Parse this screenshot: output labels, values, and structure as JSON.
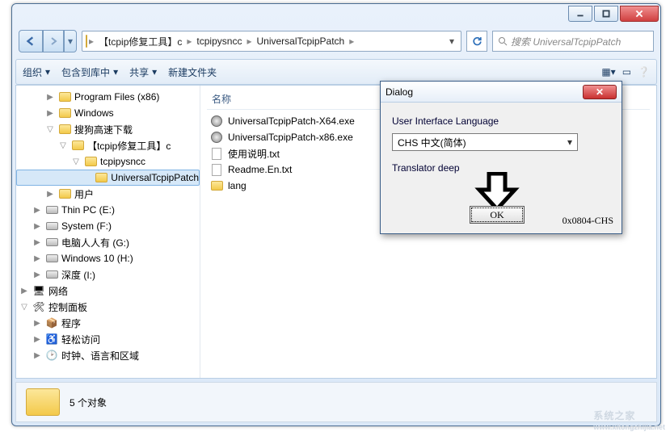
{
  "window": {
    "min_tip": "Minimize",
    "max_tip": "Maximize",
    "close_tip": "Close"
  },
  "address": {
    "crumbs": [
      "【tcpip修复工具】c",
      "tcpipysncc",
      "UniversalTcpipPatch"
    ],
    "sep": "▸"
  },
  "search": {
    "placeholder": "搜索 UniversalTcpipPatch"
  },
  "toolbar": {
    "organize": "组织",
    "include": "包含到库中",
    "share": "共享",
    "newfolder": "新建文件夹"
  },
  "columns": {
    "name": "名称"
  },
  "tree": [
    {
      "indent": 36,
      "icon": "folder",
      "label": "Program Files (x86)",
      "twisty": "▶"
    },
    {
      "indent": 36,
      "icon": "folder",
      "label": "Windows",
      "twisty": "▶"
    },
    {
      "indent": 36,
      "icon": "folder",
      "label": "搜狗高速下载",
      "twisty": "▽"
    },
    {
      "indent": 52,
      "icon": "folder",
      "label": "【tcpip修复工具】c",
      "twisty": "▽"
    },
    {
      "indent": 68,
      "icon": "folder",
      "label": "tcpipysncc",
      "twisty": "▽"
    },
    {
      "indent": 84,
      "icon": "folder",
      "label": "UniversalTcpipPatch",
      "twisty": "",
      "sel": true
    },
    {
      "indent": 36,
      "icon": "folder",
      "label": "用户",
      "twisty": "▶"
    },
    {
      "indent": 20,
      "icon": "drive",
      "label": "Thin PC (E:)",
      "twisty": "▶"
    },
    {
      "indent": 20,
      "icon": "drive",
      "label": "System (F:)",
      "twisty": "▶"
    },
    {
      "indent": 20,
      "icon": "drive",
      "label": "电脑人人有 (G:)",
      "twisty": "▶"
    },
    {
      "indent": 20,
      "icon": "drive",
      "label": "Windows 10 (H:)",
      "twisty": "▶"
    },
    {
      "indent": 20,
      "icon": "drive",
      "label": "深度 (I:)",
      "twisty": "▶"
    },
    {
      "indent": 4,
      "icon": "net",
      "label": "网络",
      "twisty": "▶"
    },
    {
      "indent": 4,
      "icon": "cpl",
      "label": "控制面板",
      "twisty": "▽"
    },
    {
      "indent": 20,
      "icon": "prog",
      "label": "程序",
      "twisty": "▶"
    },
    {
      "indent": 20,
      "icon": "ease",
      "label": "轻松访问",
      "twisty": "▶"
    },
    {
      "indent": 20,
      "icon": "clock",
      "label": "时钟、语言和区域",
      "twisty": "▶"
    }
  ],
  "files": [
    {
      "icon": "exe",
      "name": "UniversalTcpipPatch-X64.exe"
    },
    {
      "icon": "exe",
      "name": "UniversalTcpipPatch-x86.exe"
    },
    {
      "icon": "txt",
      "name": "使用说明.txt"
    },
    {
      "icon": "txt",
      "name": "Readme.En.txt"
    },
    {
      "icon": "folder",
      "name": "lang"
    }
  ],
  "status": {
    "text": "5 个对象"
  },
  "dialog": {
    "title": "Dialog",
    "lang_label": "User Interface Language",
    "combo_value": "CHS    中文(简体)",
    "translator": "Translator deep",
    "ok": "OK",
    "code": "0x0804-CHS"
  },
  "watermark": {
    "big": "系统之家",
    "small": "www.xitongzhijia.net"
  }
}
